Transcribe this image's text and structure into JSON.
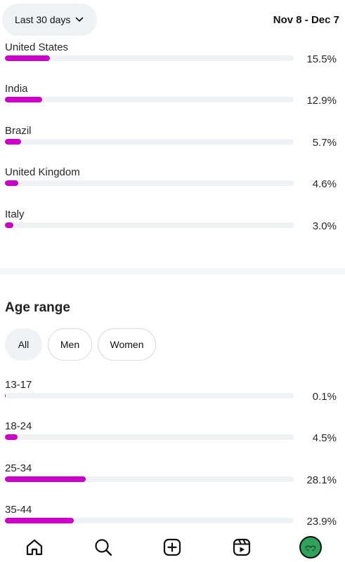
{
  "header": {
    "range_label": "Last 30 days",
    "date_range": "Nov 8 - Dec 7"
  },
  "countries": [
    {
      "label": "United States",
      "value": "15.5%",
      "fraction": 0.155
    },
    {
      "label": "India",
      "value": "12.9%",
      "fraction": 0.129
    },
    {
      "label": "Brazil",
      "value": "5.7%",
      "fraction": 0.057
    },
    {
      "label": "United Kingdom",
      "value": "4.6%",
      "fraction": 0.046
    },
    {
      "label": "Italy",
      "value": "3.0%",
      "fraction": 0.03
    }
  ],
  "age_range": {
    "title": "Age range",
    "filters": [
      "All",
      "Men",
      "Women"
    ],
    "selected_filter": "All",
    "rows": [
      {
        "label": "13-17",
        "value": "0.1%",
        "fraction": 0.001
      },
      {
        "label": "18-24",
        "value": "4.5%",
        "fraction": 0.045
      },
      {
        "label": "25-34",
        "value": "28.1%",
        "fraction": 0.281
      },
      {
        "label": "35-44",
        "value": "23.9%",
        "fraction": 0.239
      }
    ]
  },
  "bar_color": "#cc00c8",
  "avatar_color": "#2fa25c",
  "nav": {
    "icons": [
      "home-icon",
      "search-icon",
      "create-icon",
      "reels-icon",
      "profile-avatar"
    ]
  }
}
